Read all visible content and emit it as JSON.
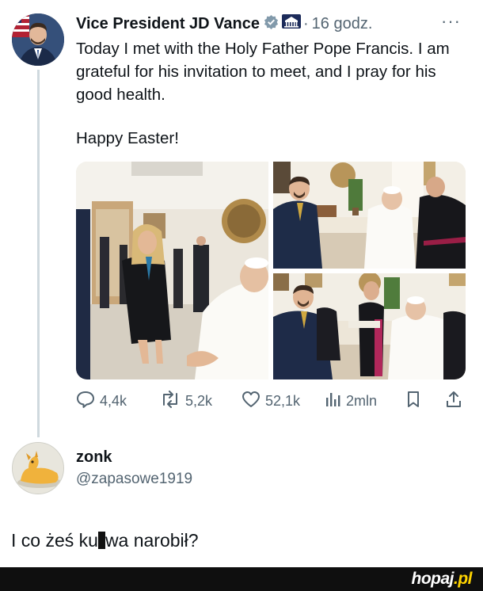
{
  "tweet": {
    "author_name": "Vice President JD Vance",
    "separator": "·",
    "time": "16 godz.",
    "more": "···",
    "text": "Today I met with the Holy Father Pope Francis. I am grateful for his invitation to meet, and I pray for his good health.",
    "text2": "Happy Easter!",
    "icons": {
      "verified": "verified-badge-icon",
      "affiliation": "white-house-icon"
    },
    "colors": {
      "verified": "#829aab",
      "thread_line": "#cfd9de",
      "muted": "#536471"
    }
  },
  "actions": {
    "replies": "4,4k",
    "reposts": "5,2k",
    "likes": "52,1k",
    "views": "2mln"
  },
  "reply": {
    "name": "zonk",
    "handle": "@zapasowe1919"
  },
  "comment": {
    "before": "I co żeś ku",
    "after": "wa narobił?"
  },
  "footer": {
    "logo_main": "hopaj",
    "logo_suffix": ".pl",
    "logo_color": "#ffd400"
  }
}
